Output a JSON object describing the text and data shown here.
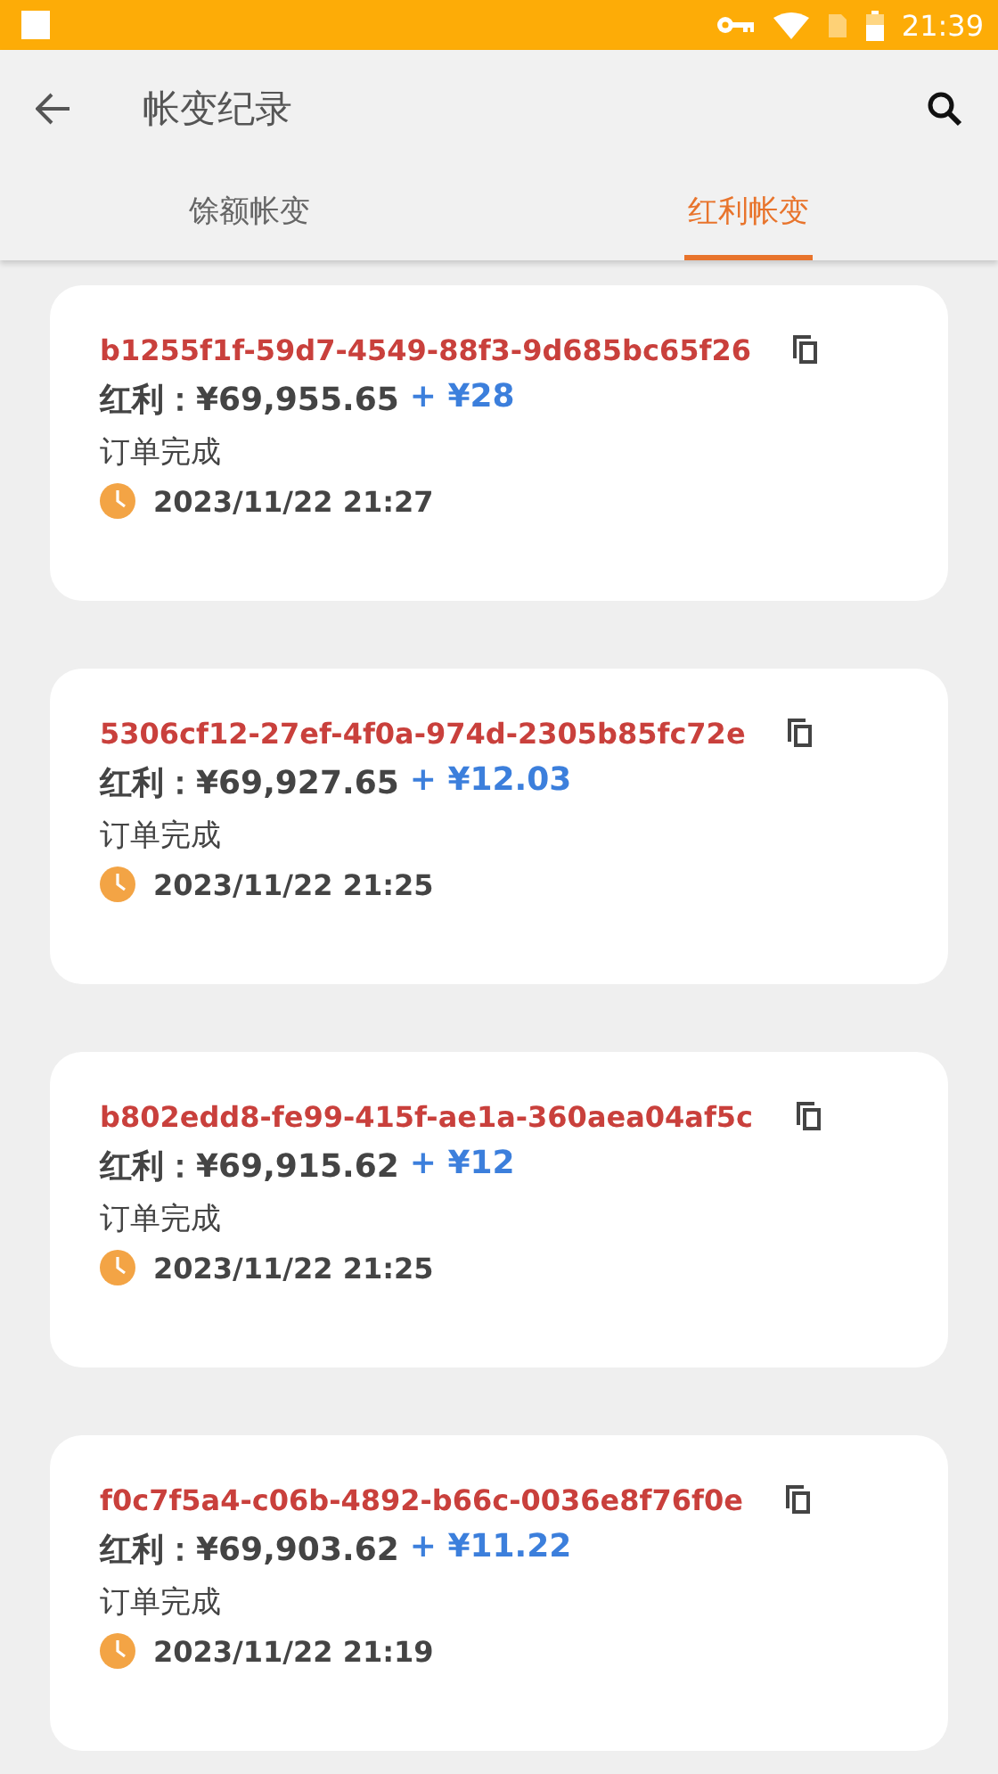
{
  "status_bar": {
    "time": "21:39"
  },
  "toolbar": {
    "title": "帐变纪录"
  },
  "tabs": [
    {
      "label": "馀额帐变",
      "selected": false
    },
    {
      "label": "红利帐变",
      "selected": true
    }
  ],
  "records": [
    {
      "id": "b1255f1f-59d7-4549-88f3-9d685bc65f26",
      "balance": "红利：¥69,955.65",
      "change": "+ ¥28",
      "status": "订单完成",
      "time": "2023/11/22 21:27"
    },
    {
      "id": "5306cf12-27ef-4f0a-974d-2305b85fc72e",
      "balance": "红利：¥69,927.65",
      "change": "+ ¥12.03",
      "status": "订单完成",
      "time": "2023/11/22 21:25"
    },
    {
      "id": "b802edd8-fe99-415f-ae1a-360aea04af5c",
      "balance": "红利：¥69,915.62",
      "change": "+ ¥12",
      "status": "订单完成",
      "time": "2023/11/22 21:25"
    },
    {
      "id": "f0c7f5a4-c06b-4892-b66c-0036e8f76f0e",
      "balance": "红利：¥69,903.62",
      "change": "+ ¥11.22",
      "status": "订单完成",
      "time": "2023/11/22 21:19"
    }
  ]
}
